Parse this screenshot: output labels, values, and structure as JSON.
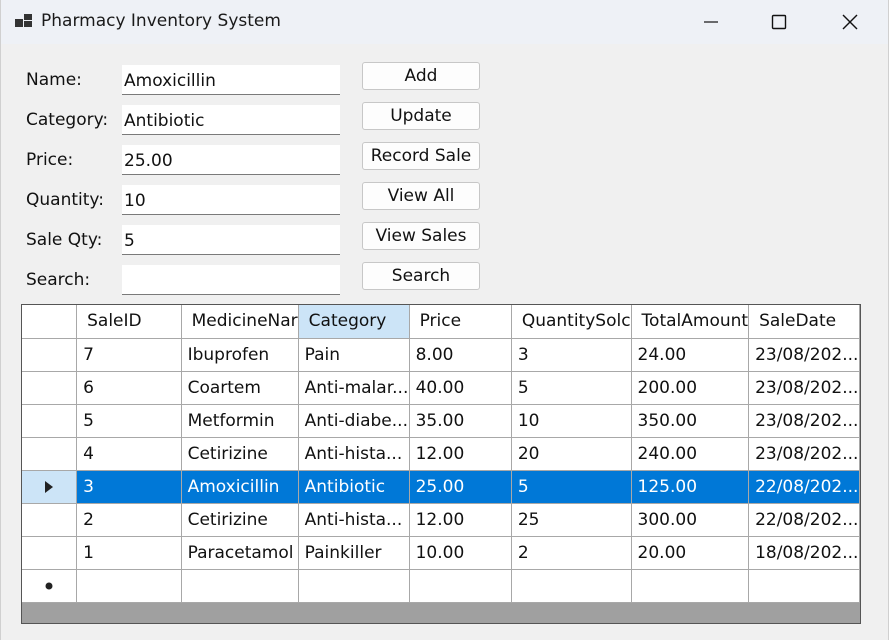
{
  "window": {
    "title": "Pharmacy Inventory System"
  },
  "form": {
    "name_label": "Name:",
    "name_value": "Amoxicillin",
    "category_label": "Category:",
    "category_value": "Antibiotic",
    "price_label": "Price:",
    "price_value": "25.00",
    "quantity_label": "Quantity:",
    "quantity_value": "10",
    "sale_qty_label": "Sale Qty:",
    "sale_qty_value": "5",
    "search_label": "Search:",
    "search_value": ""
  },
  "buttons": {
    "add": "Add",
    "update": "Update",
    "record_sale": "Record Sale",
    "view_all": "View All",
    "view_sales": "View Sales",
    "search": "Search"
  },
  "grid": {
    "columns": [
      "SaleID",
      "MedicineNar",
      "Category",
      "Price",
      "QuantitySolc",
      "TotalAmount",
      "SaleDate"
    ],
    "rows": [
      [
        "7",
        "Ibuprofen",
        "Pain",
        "8.00",
        "3",
        "24.00",
        "23/08/202..."
      ],
      [
        "6",
        "Coartem",
        "Anti-malar...",
        "40.00",
        "5",
        "200.00",
        "23/08/202..."
      ],
      [
        "5",
        "Metformin",
        "Anti-diabe...",
        "35.00",
        "10",
        "350.00",
        "23/08/202..."
      ],
      [
        "4",
        "Cetirizine",
        "Anti-hista...",
        "12.00",
        "20",
        "240.00",
        "23/08/202..."
      ],
      [
        "3",
        "Amoxicillin",
        "Antibiotic",
        "25.00",
        "5",
        "125.00",
        "22/08/202..."
      ],
      [
        "2",
        "Cetirizine",
        "Anti-hista...",
        "12.00",
        "25",
        "300.00",
        "22/08/202..."
      ],
      [
        "1",
        "Paracetamol",
        "Painkiller",
        "10.00",
        "2",
        "20.00",
        "18/08/202..."
      ]
    ]
  },
  "icons": {
    "app": "app-icon",
    "minimize": "minimize-icon",
    "maximize": "maximize-icon",
    "close": "close-icon",
    "current_row": "row-pointer-icon",
    "new_row": "new-row-icon"
  }
}
